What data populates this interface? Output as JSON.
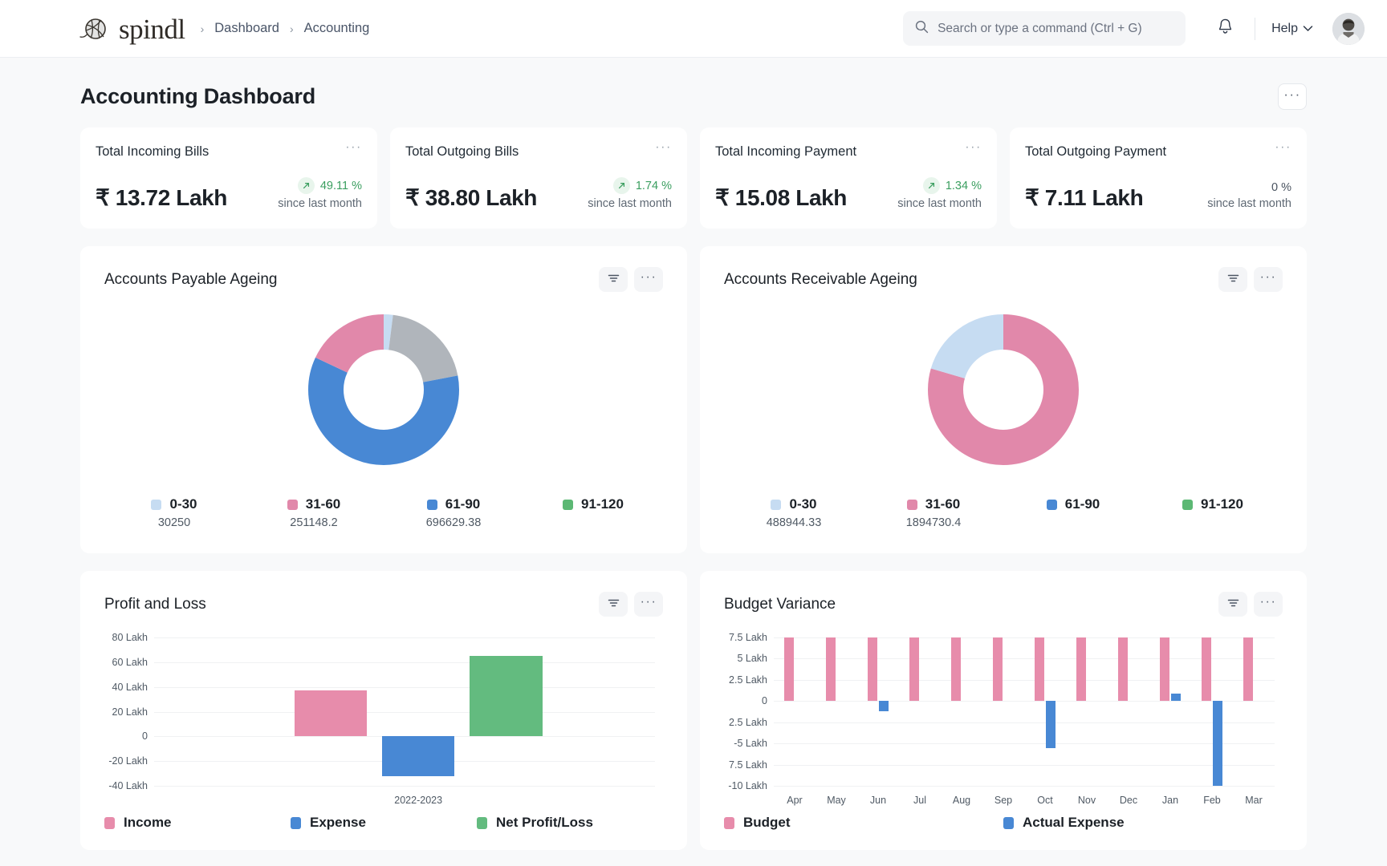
{
  "brand": {
    "name": "spindl",
    "logo_icon": "yarn-ball-icon"
  },
  "breadcrumb": {
    "items": [
      "Dashboard",
      "Accounting"
    ],
    "separator": "›"
  },
  "search": {
    "placeholder": "Search or type a command (Ctrl + G)",
    "value": "",
    "icon": "search-icon"
  },
  "nav": {
    "bell_icon": "bell-icon",
    "help_label": "Help",
    "help_caret_icon": "chevron-down-icon",
    "avatar_icon": "user-avatar"
  },
  "page": {
    "title": "Accounting Dashboard",
    "menu_label": "···"
  },
  "kpis": [
    {
      "label": "Total Incoming Bills",
      "value": "₹ 13.72 Lakh",
      "pct": "49.11 %",
      "sub": "since last month",
      "trend": "up",
      "menu": "···"
    },
    {
      "label": "Total Outgoing Bills",
      "value": "₹ 38.80 Lakh",
      "pct": "1.74 %",
      "sub": "since last month",
      "trend": "up",
      "menu": "···"
    },
    {
      "label": "Total Incoming Payment",
      "value": "₹ 15.08 Lakh",
      "pct": "1.34 %",
      "sub": "since last month",
      "trend": "up",
      "menu": "···"
    },
    {
      "label": "Total Outgoing Payment",
      "value": "₹ 7.11 Lakh",
      "pct": "0 %",
      "sub": "since last month",
      "trend": "flat",
      "menu": "···"
    }
  ],
  "cards": {
    "payable": {
      "title": "Accounts Payable Ageing",
      "filter_icon": "filter-icon",
      "menu": "···"
    },
    "receivable": {
      "title": "Accounts Receivable Ageing",
      "filter_icon": "filter-icon",
      "menu": "···"
    },
    "pnl": {
      "title": "Profit and Loss",
      "filter_icon": "filter-icon",
      "menu": "···"
    },
    "budget": {
      "title": "Budget Variance",
      "filter_icon": "filter-icon",
      "menu": "···"
    }
  },
  "colors": {
    "light_blue": "#c6dcf2",
    "pink": "#e188aa",
    "blue": "#4888d4",
    "green": "#5cb874",
    "grey": "#b0b5bb",
    "pink_soft": "#e78cab",
    "green_soft": "#63bb7f",
    "positive": "#3a9e5f"
  },
  "chart_data": [
    {
      "type": "pie",
      "title": "Accounts Payable Ageing",
      "legend_position": "bottom",
      "labels": [
        "0-30",
        "31-60",
        "61-90",
        "91-120"
      ],
      "values": [
        30250,
        251148.2,
        696629.38,
        0
      ],
      "value_labels": [
        "30250",
        "251148.2",
        "696629.38",
        ""
      ],
      "colors": [
        "#c6dcf2",
        "#e188aa",
        "#4888d4",
        "#5cb874"
      ],
      "extra_slice": {
        "label": "unlabelled",
        "color": "#b0b5bb",
        "fraction": 0.2
      },
      "slice_fractions": [
        0.02,
        0.18,
        0.6,
        0.2
      ]
    },
    {
      "type": "pie",
      "title": "Accounts Receivable Ageing",
      "legend_position": "bottom",
      "labels": [
        "0-30",
        "31-60",
        "61-90",
        "91-120"
      ],
      "values": [
        488944.33,
        1894730.4,
        0,
        0
      ],
      "value_labels": [
        "488944.33",
        "1894730.4",
        "",
        ""
      ],
      "colors": [
        "#c6dcf2",
        "#e188aa",
        "#4888d4",
        "#5cb874"
      ],
      "slice_fractions": [
        0.205,
        0.795,
        0,
        0
      ]
    },
    {
      "type": "bar",
      "title": "Profit and Loss",
      "categories": [
        "2022-2023"
      ],
      "xlabel": "",
      "ylabel": "",
      "ytick_labels": [
        "80 Lakh",
        "60 Lakh",
        "40 Lakh",
        "20 Lakh",
        "0",
        "-20 Lakh",
        "-40 Lakh"
      ],
      "ytick_values": [
        80,
        60,
        40,
        20,
        0,
        -20,
        -40
      ],
      "ylim": [
        -40,
        80
      ],
      "grid": true,
      "legend_position": "bottom",
      "series": [
        {
          "name": "Income",
          "color": "#e78cab",
          "values": [
            37
          ]
        },
        {
          "name": "Expense",
          "color": "#4888d4",
          "values": [
            -32
          ]
        },
        {
          "name": "Net Profit/Loss",
          "color": "#63bb7f",
          "values": [
            65
          ]
        }
      ]
    },
    {
      "type": "bar",
      "title": "Budget Variance",
      "categories": [
        "Apr",
        "May",
        "Jun",
        "Jul",
        "Aug",
        "Sep",
        "Oct",
        "Nov",
        "Dec",
        "Jan",
        "Feb",
        "Mar"
      ],
      "xlabel": "",
      "ylabel": "",
      "ytick_labels": [
        "7.5 Lakh",
        "5 Lakh",
        "2.5 Lakh",
        "0",
        "2.5 Lakh",
        "-5 Lakh",
        "7.5 Lakh",
        "-10 Lakh"
      ],
      "ytick_values": [
        7.5,
        5,
        2.5,
        0,
        -2.5,
        -5,
        -7.5,
        -10
      ],
      "ylim": [
        -10,
        7.5
      ],
      "grid": true,
      "legend_position": "bottom",
      "series": [
        {
          "name": "Budget",
          "color": "#e78cab",
          "values": [
            7.5,
            7.5,
            7.5,
            7.5,
            7.5,
            7.5,
            7.5,
            7.5,
            7.5,
            7.5,
            7.5,
            7.5
          ]
        },
        {
          "name": "Actual Expense",
          "color": "#4888d4",
          "values": [
            0,
            0,
            -1.2,
            0,
            0,
            0,
            -5.6,
            0,
            0,
            0.9,
            -10,
            0
          ]
        }
      ]
    }
  ]
}
